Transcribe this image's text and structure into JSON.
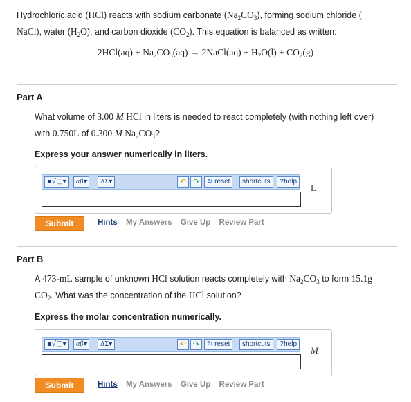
{
  "intro": {
    "t1": "Hydrochloric acid (",
    "hcl": "HCl",
    "t2": ") reacts with sodium carbonate (",
    "na2co3": "Na",
    "t3": "), forming sodium chloride (",
    "nacl": "NaCl",
    "t4": "), water (",
    "h2o": "H",
    "t5": "), and carbon dioxide (",
    "co2": "CO",
    "t6": "). This equation is balanced as written:"
  },
  "equation": "2HCl(aq) + Na₂CO₃(aq) → 2NaCl(aq) + H₂O(l) + CO₂(g)",
  "partA": {
    "title": "Part A",
    "q1": "What volume of ",
    "conc1": "3.00",
    "M1": "M",
    "hcl": "HCl",
    "q2": " in liters is needed to react completely (with nothing left over)",
    "q3": "with ",
    "vol": "0.750",
    "L": "L",
    "q4": " of ",
    "conc2": "0.300",
    "M2": "M",
    "na2co3": "Na₂CO₃",
    "q5": "?",
    "express": "Express your answer numerically in liters.",
    "unit": "L",
    "answer": ""
  },
  "partB": {
    "title": "Part B",
    "q1": "A ",
    "vol": "473",
    "mL": "-mL",
    "q2": " sample of unknown ",
    "hcl": "HCl",
    "q3": " solution reacts completely with ",
    "na2co3": "Na₂CO₃",
    "q4": " to form ",
    "mass": "15.1",
    "g": "g",
    "co2": "CO₂",
    "q5": ". What was the concentration of the ",
    "hcl2": "HCl",
    "q6": " solution?",
    "express": "Express the molar concentration numerically.",
    "unit": "M",
    "answer": ""
  },
  "toolbar": {
    "templates": "▪√□",
    "greek": "αβ",
    "symbols": "ΔΣ",
    "undo": "↶",
    "redo": "↷",
    "reset": "reset",
    "shortcuts": "shortcuts",
    "help_q": "?",
    "help": "help"
  },
  "actions": {
    "submit": "Submit",
    "hints": "Hints",
    "my_answers": "My Answers",
    "give_up": "Give Up",
    "review": "Review Part"
  }
}
